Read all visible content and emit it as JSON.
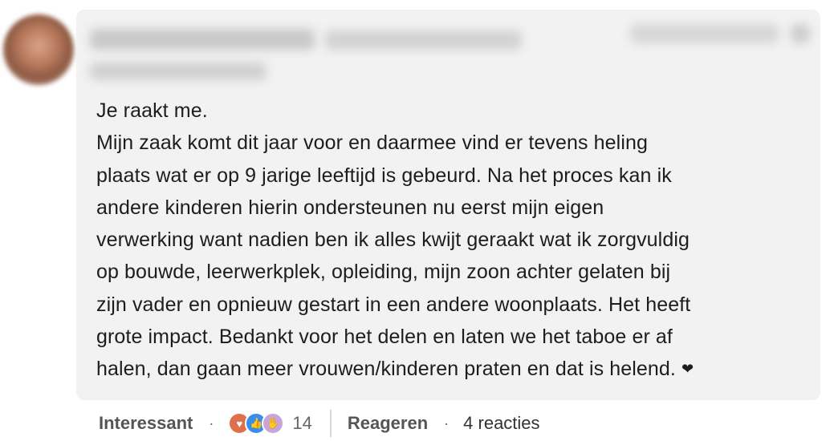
{
  "comment": {
    "text_lines": [
      "Je raakt me.",
      "Mijn zaak komt dit jaar voor en daarmee vind er tevens heling",
      "plaats wat er op 9 jarige leeftijd is gebeurd. Na het proces kan ik",
      "andere kinderen hierin ondersteunen nu eerst mijn eigen",
      "verwerking want nadien ben ik alles kwijt geraakt wat ik zorgvuldig",
      "op bouwde, leerwerkplek, opleiding, mijn zoon achter gelaten bij",
      "zijn vader en opnieuw gestart in een andere woonplaats. Het heeft",
      "grote impact. Bedankt voor het delen en laten we het taboe er af",
      "halen, dan gaan meer vrouwen/kinderen praten en dat is helend."
    ],
    "end_emoji": "❤"
  },
  "actions": {
    "like_label": "Interessant",
    "separator": "·",
    "reaction_icons": [
      "heart-reaction-icon",
      "like-reaction-icon",
      "insightful-reaction-icon"
    ],
    "reaction_count": "14",
    "reply_label": "Reageren",
    "replies_label": "4 reacties"
  },
  "colors": {
    "bubble": "#f2f2f2",
    "text": "#1d1d1d",
    "action": "#555555"
  }
}
